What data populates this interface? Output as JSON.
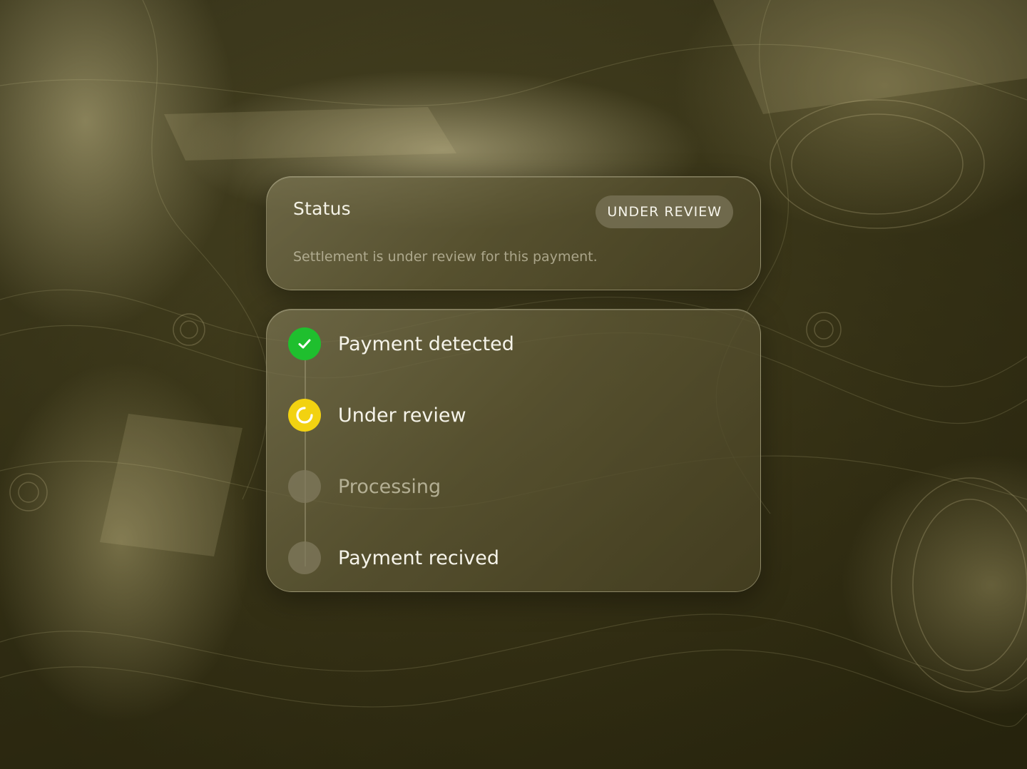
{
  "colors": {
    "done": "#1fbf2e",
    "active": "#f2d211",
    "pending": "#807a5e",
    "text_primary": "#f6f4ea",
    "text_muted": "#d7d2ba"
  },
  "status_card": {
    "title": "Status",
    "badge": "UNDER REVIEW",
    "description": "Settlement is under review for this payment."
  },
  "steps": [
    {
      "label": "Payment detected",
      "state": "done",
      "icon": "check-icon"
    },
    {
      "label": "Under review",
      "state": "active",
      "icon": "spinner-icon"
    },
    {
      "label": "Processing",
      "state": "pending",
      "icon": "pending-circle-icon"
    },
    {
      "label": "Payment recived",
      "state": "pending",
      "icon": "pending-circle-icon"
    }
  ]
}
